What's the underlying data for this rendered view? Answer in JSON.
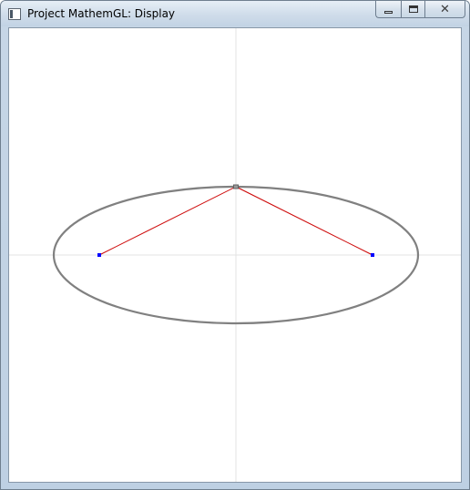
{
  "window": {
    "title": "Project MathemGL: Display",
    "buttons": {
      "minimize_icon": "minimize-icon",
      "maximize_icon": "maximize-icon",
      "close_icon": "close-icon",
      "close_glyph": "✕"
    }
  },
  "chart_data": {
    "type": "scatter",
    "xlim": [
      -1,
      1
    ],
    "ylim": [
      -1,
      1
    ],
    "grid": false,
    "axes_color": "#e3e3e3",
    "ellipse": {
      "center": [
        0,
        0
      ],
      "rx": 0.8,
      "ry": 0.3,
      "color": "#808080"
    },
    "foci": [
      {
        "x": -0.6,
        "y": 0,
        "color": "#0000ff"
      },
      {
        "x": 0.6,
        "y": 0,
        "color": "#0000ff"
      }
    ],
    "point_on_ellipse": {
      "x": 0,
      "y": 0.3,
      "color": "#606060"
    },
    "focal_lines_color": "#cc0000"
  }
}
